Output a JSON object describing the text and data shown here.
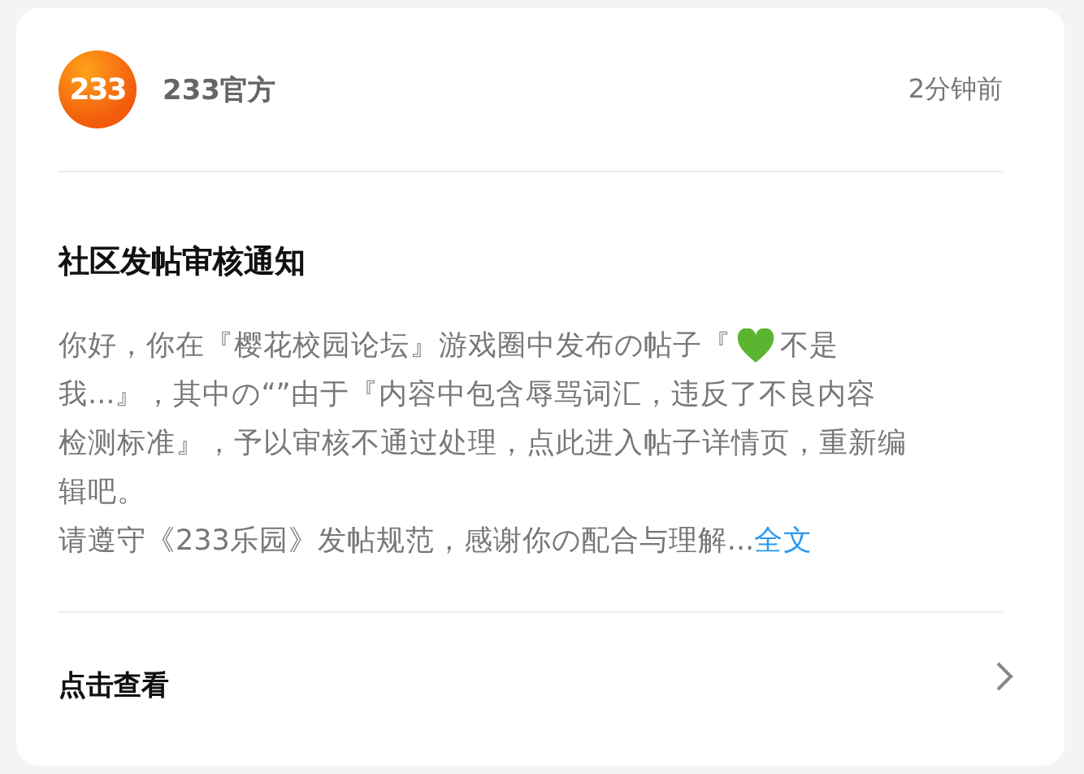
{
  "header": {
    "avatar_text": "233",
    "author": "233官方",
    "time": "2分钟前"
  },
  "title": "社区发帖审核通知",
  "body": {
    "lines": [
      {
        "text": "你好，你在『樱花校园论坛』游戏圈中发布の帖子『",
        "after_icon": "不是"
      },
      {
        "text": "我...』，其中の“”由于『内容中包含辱骂词汇，违反了不良内容"
      },
      {
        "text": "检测标准』，予以审核不通过处理，点此进入帖子详情页，重新编"
      },
      {
        "text": "辑吧。"
      }
    ],
    "closing": "请遵守《233乐园》发帖规范，感谢你の配合与理解...",
    "link": "全文"
  },
  "footer": {
    "label": "点击查看"
  }
}
